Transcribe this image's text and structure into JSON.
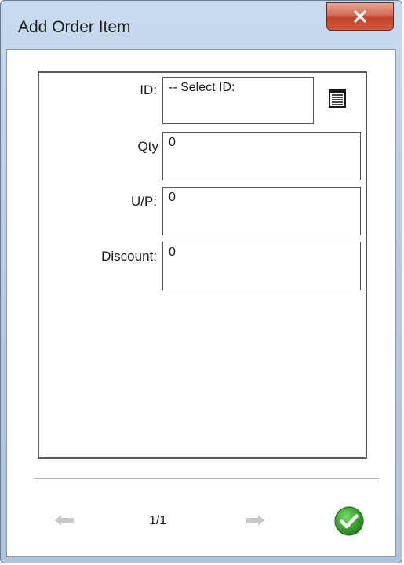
{
  "window": {
    "title": "Add Order Item"
  },
  "form": {
    "id": {
      "label": "ID:",
      "value": "-- Select ID:"
    },
    "qty": {
      "label": "Qty",
      "value": "0"
    },
    "unit_price": {
      "label": "U/P:",
      "value": "0"
    },
    "discount": {
      "label": "Discount:",
      "value": "0"
    }
  },
  "footer": {
    "page_indicator": "1/1"
  },
  "icons": {
    "close": "close-icon",
    "lookup": "list-icon",
    "prev": "arrow-left-icon",
    "next": "arrow-right-icon",
    "confirm": "checkmark-icon"
  },
  "colors": {
    "close_button": "#c9452d",
    "confirm": "#3fa535",
    "nav_disabled": "#c8c8c8"
  }
}
